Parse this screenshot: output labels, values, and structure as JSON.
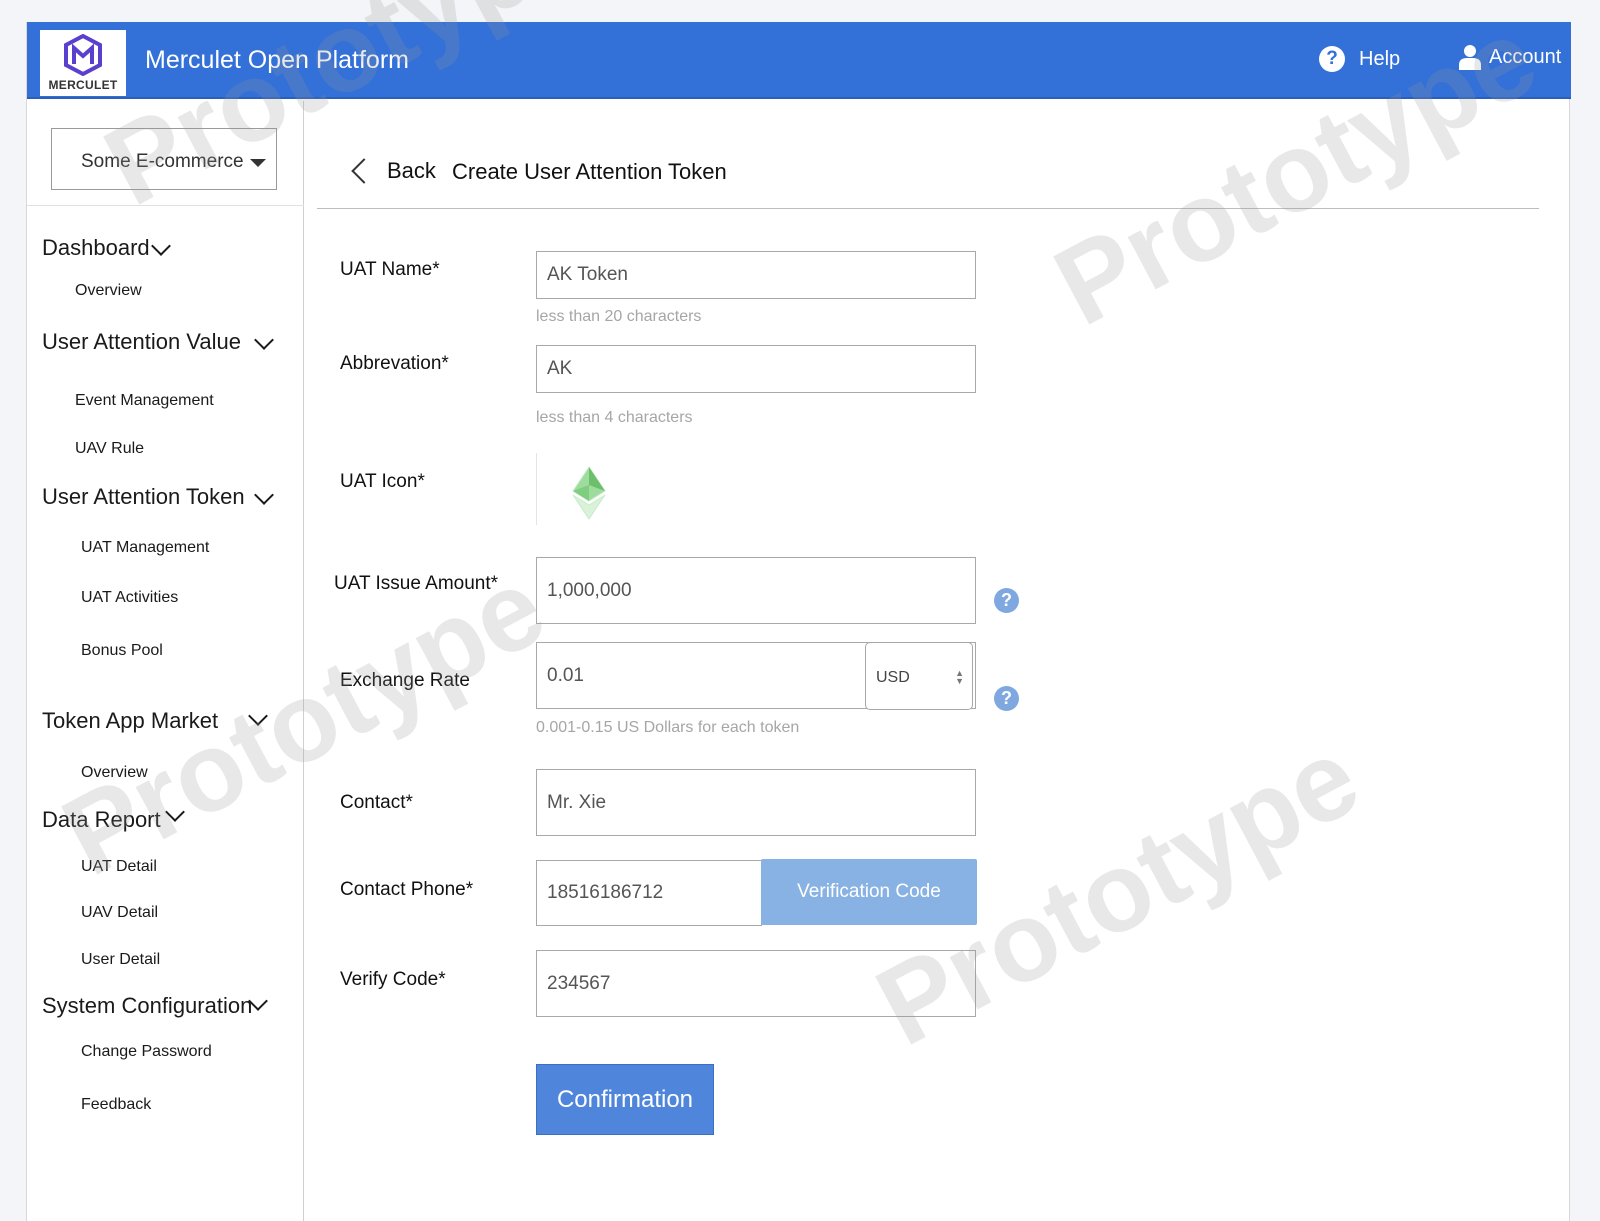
{
  "header": {
    "logo_text": "MERCULET",
    "app_title": "Merculet Open Platform",
    "help_label": "Help",
    "help_icon": "?",
    "account_label": "Account"
  },
  "sidebar": {
    "org_select": "Some E-commerce",
    "sections": {
      "dashboard": {
        "label": "Dashboard",
        "items": [
          "Overview"
        ]
      },
      "uav": {
        "label": "User Attention Value",
        "items": [
          "Event Management",
          "UAV Rule"
        ]
      },
      "uat": {
        "label": "User Attention Token",
        "items": [
          "UAT Management",
          "UAT Activities",
          "Bonus Pool"
        ]
      },
      "market": {
        "label": "Token App Market",
        "items": [
          "Overview"
        ]
      },
      "report": {
        "label": "Data Report",
        "items": [
          "UAT Detail",
          "UAV Detail",
          "User Detail"
        ]
      },
      "config": {
        "label": "System Configuration",
        "items": [
          "Change Password",
          "Feedback"
        ]
      }
    }
  },
  "main": {
    "back_label": "Back",
    "page_title": "Create User Attention Token",
    "form": {
      "name_label": "UAT Name*",
      "name_value": "AK Token",
      "name_hint": "less than 20 characters",
      "abbr_label": "Abbrevation*",
      "abbr_value": "AK",
      "abbr_hint": "less than 4 characters",
      "icon_label": "UAT Icon*",
      "issue_label": "UAT Issue Amount*",
      "issue_value": "1,000,000",
      "rate_label": "Exchange Rate",
      "rate_value": "0.01",
      "currency": "USD",
      "rate_hint": "0.001-0.15 US Dollars for each token",
      "contact_label": "Contact*",
      "contact_value": "Mr. Xie",
      "phone_label": "Contact Phone*",
      "phone_value": "18516186712",
      "verify_button": "Verification Code",
      "code_label": "Verify Code*",
      "code_value": "234567",
      "confirm_button": "Confirmation",
      "question_icon": "?"
    }
  },
  "watermark": "Prototype",
  "colors": {
    "header_bg": "#3370d8",
    "verify_button_bg": "#88b2e4",
    "confirm_button_bg": "#4f86dc",
    "hint_text": "#a6a6a6",
    "help_icon_bg": "#7fa8e0"
  }
}
